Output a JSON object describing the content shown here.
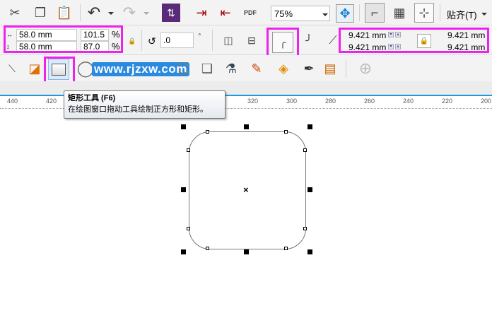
{
  "toolbar1": {
    "zoom_value": "75%",
    "snap_label": "贴齐(T)"
  },
  "property_bar": {
    "width": "58.0 mm",
    "height": "58.0 mm",
    "scale_x": "101.5",
    "scale_y": "87.0",
    "percent": "%",
    "rotation": ".0",
    "degree": "°",
    "corner_radii": {
      "top_left": "9.421 mm",
      "bottom_left": "9.421 mm",
      "top_right": "9.421 mm",
      "bottom_right": "9.421 mm"
    }
  },
  "watermark": "www.rjzxw.com",
  "tooltip": {
    "title": "矩形工具 (F6)",
    "description": "在绘图窗口拖动工具绘制正方形和矩形。"
  },
  "ruler": {
    "labels": [
      "440",
      "420",
      "320",
      "300",
      "280",
      "260",
      "240",
      "220",
      "200"
    ]
  },
  "colors": {
    "highlight": "#ee22ee",
    "ruler_line": "#1e9be0"
  }
}
